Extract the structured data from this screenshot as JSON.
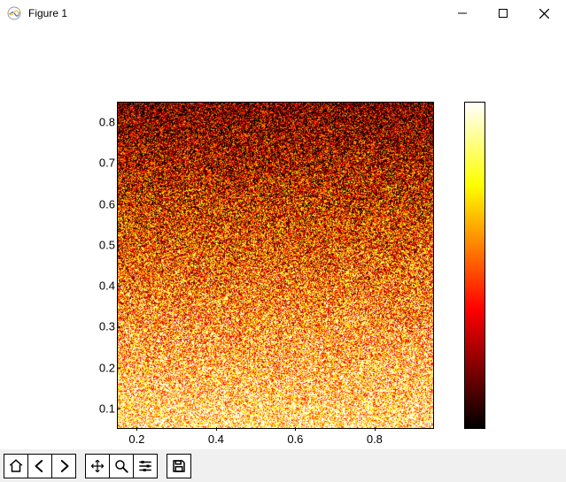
{
  "window": {
    "title": "Figure 1",
    "minimize": "Minimize",
    "maximize": "Maximize",
    "close": "Close"
  },
  "toolbar": {
    "home": "Home",
    "back": "Back",
    "forward": "Forward",
    "pan": "Pan",
    "zoom": "Zoom",
    "configure": "Configure subplots",
    "save": "Save"
  },
  "chart_data": {
    "type": "heatmap",
    "description": "Dense noisy 2D field with 'hot' colormap; mean intensity increases from top (dark/black-red) to bottom (bright yellow-white).",
    "colormap": "hot",
    "x_range": [
      0.15,
      0.95
    ],
    "y_range": [
      0.05,
      0.85
    ],
    "x_ticks": [
      0.2,
      0.4,
      0.6,
      0.8
    ],
    "y_ticks": [
      0.1,
      0.2,
      0.3,
      0.4,
      0.5,
      0.6,
      0.7,
      0.8
    ],
    "x_tick_labels": [
      "0.2",
      "0.4",
      "0.6",
      "0.8"
    ],
    "y_tick_labels": [
      "0.1",
      "0.2",
      "0.3",
      "0.4",
      "0.5",
      "0.6",
      "0.7",
      "0.8"
    ],
    "colorbar": {
      "range": [
        0.0,
        1.0
      ],
      "tick_labels": []
    },
    "value_gradient": {
      "top_mean": 0.15,
      "bottom_mean": 0.85,
      "noise_amplitude": 0.45
    },
    "title": "",
    "xlabel": "",
    "ylabel": ""
  }
}
